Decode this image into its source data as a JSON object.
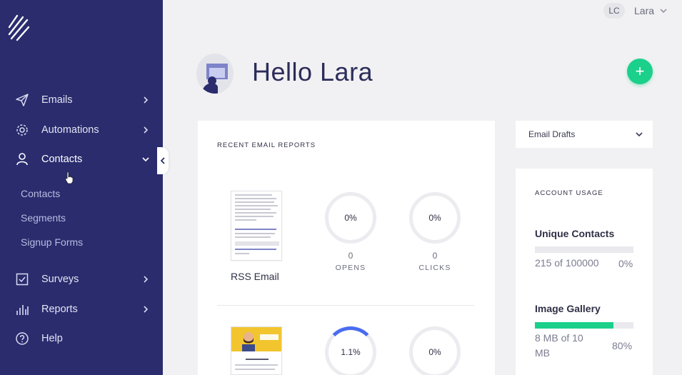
{
  "sidebar": {
    "items": [
      {
        "label": "Emails",
        "icon": "paper-plane-icon"
      },
      {
        "label": "Automations",
        "icon": "gear-icon"
      },
      {
        "label": "Contacts",
        "icon": "person-icon"
      },
      {
        "label": "Surveys",
        "icon": "checklist-icon"
      },
      {
        "label": "Reports",
        "icon": "bar-chart-icon"
      },
      {
        "label": "Help",
        "icon": "question-circle-icon"
      }
    ],
    "contacts_subitems": [
      "Contacts",
      "Segments",
      "Signup Forms"
    ]
  },
  "topbar": {
    "initials": "LC",
    "user_name": "Lara"
  },
  "header": {
    "greeting": "Hello Lara",
    "add_label": "+"
  },
  "reports": {
    "title": "RECENT EMAIL REPORTS",
    "emails": [
      {
        "name": "RSS Email",
        "opens_pct": "0%",
        "opens_count": "0",
        "clicks_pct": "0%",
        "clicks_count": "0",
        "opens_fraction": 0.0
      },
      {
        "name": "",
        "opens_pct": "1.1%",
        "clicks_pct": "0%",
        "opens_fraction": 0.011
      }
    ],
    "opens_label": "OPENS",
    "clicks_label": "CLICKS"
  },
  "drafts": {
    "selected": "Email Drafts"
  },
  "usage": {
    "title": "ACCOUNT USAGE",
    "items": [
      {
        "heading": "Unique Contacts",
        "value": "215 of 100000",
        "pct": "0%",
        "fraction": 0.0
      },
      {
        "heading": "Image Gallery",
        "value": "8 MB of 10 MB",
        "pct": "80%",
        "fraction": 0.8
      }
    ]
  },
  "colors": {
    "sidebar": "#2a2c6e",
    "accent": "#1bd08a",
    "ring_track": "#ececf0"
  }
}
